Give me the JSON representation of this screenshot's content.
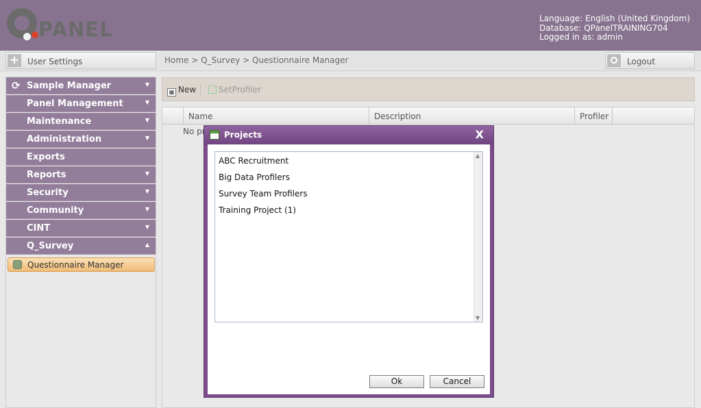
{
  "header": {
    "logo_text": "PANEL",
    "session": {
      "language": "Language: English (United Kingdom)",
      "database": "Database: QPanelTRAINING704",
      "logged_in": "Logged in as: admin"
    }
  },
  "topbar": {
    "user_settings_label": "User Settings",
    "breadcrumb": "Home > Q_Survey > Questionnaire Manager",
    "logout_label": "Logout"
  },
  "sidebar": {
    "items": [
      {
        "label": "Sample Manager"
      },
      {
        "label": "Panel Management"
      },
      {
        "label": "Maintenance"
      },
      {
        "label": "Administration"
      },
      {
        "label": "Exports"
      },
      {
        "label": "Reports"
      },
      {
        "label": "Security"
      },
      {
        "label": "Community"
      },
      {
        "label": "CINT"
      },
      {
        "label": "Q_Survey"
      }
    ],
    "active_sub": "Questionnaire Manager"
  },
  "toolbar": {
    "new_label": "New",
    "setprofiler_label": "SetProfiler"
  },
  "grid": {
    "columns": [
      "Name",
      "Description",
      "Profiler"
    ],
    "empty_text": "No pr"
  },
  "modal": {
    "title": "Projects",
    "close_glyph": "X",
    "projects": [
      "ABC Recruitment",
      "Big Data Profilers",
      "Survey Team Profilers",
      "Training Project (1)"
    ],
    "ok_label": "Ok",
    "cancel_label": "Cancel"
  },
  "colors": {
    "header_bg": "#87738f",
    "nav_bg": "#927d9a",
    "modal_frame": "#7a4c8a",
    "active_item": "#f0bc77"
  }
}
